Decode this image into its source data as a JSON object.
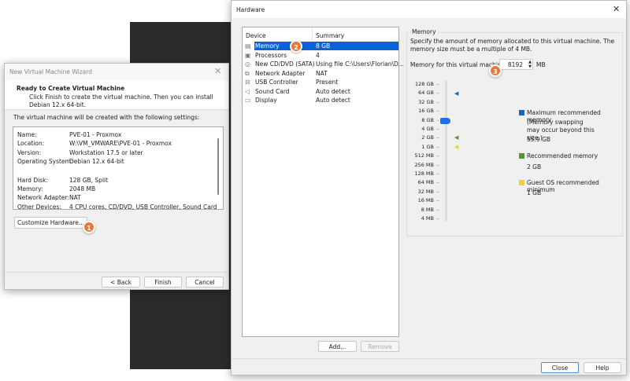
{
  "wizard": {
    "title": "New Virtual Machine Wizard",
    "heading": "Ready to Create Virtual Machine",
    "description": "Click Finish to create the virtual machine. Then you can install Debian 12.x 64-bit.",
    "intro": "The virtual machine will be created with the following settings:",
    "settings": [
      {
        "label": "Name:",
        "value": "PVE-01 - Proxmox"
      },
      {
        "label": "Location:",
        "value": "W:\\VM_VMWARE\\PVE-01 - Proxmox"
      },
      {
        "label": "Version:",
        "value": "Workstation 17.5 or later"
      },
      {
        "label": "Operating System:",
        "value": "Debian 12.x 64-bit"
      },
      {
        "label": "Hard Disk:",
        "value": "128 GB, Split"
      },
      {
        "label": "Memory:",
        "value": "2048 MB"
      },
      {
        "label": "Network Adapter:",
        "value": "NAT"
      },
      {
        "label": "Other Devices:",
        "value": "4 CPU cores, CD/DVD, USB Controller, Sound Card"
      }
    ],
    "customize_label": "Customize Hardware...",
    "back_label": "< Back",
    "finish_label": "Finish",
    "cancel_label": "Cancel"
  },
  "badges": [
    "1",
    "2",
    "3"
  ],
  "hardware": {
    "title": "Hardware",
    "columns": [
      "Device",
      "Summary"
    ],
    "devices": [
      {
        "name": "Memory",
        "summary": "8 GB",
        "icon": "memory-icon",
        "selected": true
      },
      {
        "name": "Processors",
        "summary": "4",
        "icon": "cpu-icon"
      },
      {
        "name": "New CD/DVD (SATA)",
        "summary": "Using file C:\\Users\\Florian\\D...",
        "icon": "cd-icon"
      },
      {
        "name": "Network Adapter",
        "summary": "NAT",
        "icon": "network-icon"
      },
      {
        "name": "USB Controller",
        "summary": "Present",
        "icon": "usb-icon"
      },
      {
        "name": "Sound Card",
        "summary": "Auto detect",
        "icon": "speaker-icon"
      },
      {
        "name": "Display",
        "summary": "Auto detect",
        "icon": "monitor-icon"
      }
    ],
    "add_label": "Add...",
    "remove_label": "Remove",
    "close_label": "Close",
    "help_label": "Help",
    "memory": {
      "group_label": "Memory",
      "description": "Specify the amount of memory allocated to this virtual machine. The memory size must be a multiple of 4 MB.",
      "field_label": "Memory for this virtual machine:",
      "value": "8192",
      "unit": "MB",
      "scale": [
        "128 GB",
        "64 GB",
        "32 GB",
        "16 GB",
        "8 GB",
        "4 GB",
        "2 GB",
        "1 GB",
        "512 MB",
        "256 MB",
        "128 MB",
        "64 MB",
        "32 MB",
        "16 MB",
        "8 MB",
        "4 MB"
      ],
      "slider_value": "8 GB",
      "max_label": "Maximum recommended memory",
      "max_note": "(Memory swapping may occur beyond this size.)",
      "max_value": "55.9 GB",
      "rec_label": "Recommended memory",
      "rec_value": "2 GB",
      "min_label": "Guest OS recommended minimum",
      "min_value": "1 GB",
      "colors": {
        "max": "#1565c0",
        "rec": "#4e9a2a",
        "min": "#f2d21b",
        "thumb": "#1a73e8",
        "selection": "#0a64d8"
      }
    }
  }
}
